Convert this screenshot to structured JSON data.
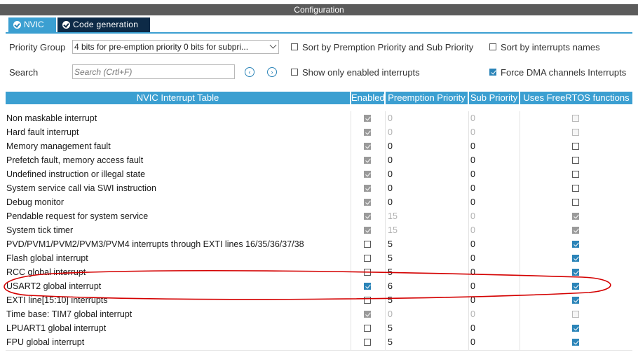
{
  "window": {
    "title": "Configuration"
  },
  "tabs": [
    {
      "label": "NVIC",
      "active": true
    },
    {
      "label": "Code generation",
      "active": false
    }
  ],
  "controls": {
    "priority_group_label": "Priority Group",
    "priority_group_value": "4 bits for pre-emption priority 0 bits for subpri...",
    "search_label": "Search",
    "search_placeholder": "Search (Crtl+F)",
    "sort_priority_label": "Sort by Premption Priority and Sub Priority",
    "sort_priority_checked": false,
    "sort_names_label": "Sort by interrupts names",
    "sort_names_checked": false,
    "show_enabled_label": "Show only enabled interrupts",
    "show_enabled_checked": false,
    "force_dma_label": "Force DMA channels Interrupts",
    "force_dma_checked": true
  },
  "table": {
    "headers": [
      "NVIC Interrupt Table",
      "Enabled",
      "Preemption Priority",
      "Sub Priority",
      "Uses FreeRTOS functions"
    ],
    "rows": [
      {
        "name": "Non maskable interrupt",
        "enabled": true,
        "enabled_locked": true,
        "preemption": "0",
        "sub": "0",
        "values_locked": true,
        "freertos": false,
        "freertos_locked": true
      },
      {
        "name": "Hard fault interrupt",
        "enabled": true,
        "enabled_locked": true,
        "preemption": "0",
        "sub": "0",
        "values_locked": true,
        "freertos": false,
        "freertos_locked": true
      },
      {
        "name": "Memory management fault",
        "enabled": true,
        "enabled_locked": true,
        "preemption": "0",
        "sub": "0",
        "values_locked": false,
        "freertos": false,
        "freertos_locked": false
      },
      {
        "name": "Prefetch fault, memory access fault",
        "enabled": true,
        "enabled_locked": true,
        "preemption": "0",
        "sub": "0",
        "values_locked": false,
        "freertos": false,
        "freertos_locked": false
      },
      {
        "name": "Undefined instruction or illegal state",
        "enabled": true,
        "enabled_locked": true,
        "preemption": "0",
        "sub": "0",
        "values_locked": false,
        "freertos": false,
        "freertos_locked": false
      },
      {
        "name": "System service call via SWI instruction",
        "enabled": true,
        "enabled_locked": true,
        "preemption": "0",
        "sub": "0",
        "values_locked": false,
        "freertos": false,
        "freertos_locked": false
      },
      {
        "name": "Debug monitor",
        "enabled": true,
        "enabled_locked": true,
        "preemption": "0",
        "sub": "0",
        "values_locked": false,
        "freertos": false,
        "freertos_locked": false
      },
      {
        "name": "Pendable request for system service",
        "enabled": true,
        "enabled_locked": true,
        "preemption": "15",
        "sub": "0",
        "values_locked": true,
        "freertos": true,
        "freertos_locked": true
      },
      {
        "name": "System tick timer",
        "enabled": true,
        "enabled_locked": true,
        "preemption": "15",
        "sub": "0",
        "values_locked": true,
        "freertos": true,
        "freertos_locked": true
      },
      {
        "name": "PVD/PVM1/PVM2/PVM3/PVM4 interrupts through EXTI lines 16/35/36/37/38",
        "enabled": false,
        "enabled_locked": false,
        "preemption": "5",
        "sub": "0",
        "values_locked": false,
        "freertos": true,
        "freertos_locked": false
      },
      {
        "name": "Flash global interrupt",
        "enabled": false,
        "enabled_locked": false,
        "preemption": "5",
        "sub": "0",
        "values_locked": false,
        "freertos": true,
        "freertos_locked": false
      },
      {
        "name": "RCC global interrupt",
        "enabled": false,
        "enabled_locked": false,
        "preemption": "5",
        "sub": "0",
        "values_locked": false,
        "freertos": true,
        "freertos_locked": false
      },
      {
        "name": "USART2 global interrupt",
        "enabled": true,
        "enabled_locked": false,
        "preemption": "6",
        "sub": "0",
        "values_locked": false,
        "freertos": true,
        "freertos_locked": false
      },
      {
        "name": "EXTI line[15:10] interrupts",
        "enabled": false,
        "enabled_locked": false,
        "preemption": "5",
        "sub": "0",
        "values_locked": false,
        "freertos": true,
        "freertos_locked": false
      },
      {
        "name": "Time base: TIM7 global interrupt",
        "enabled": true,
        "enabled_locked": true,
        "preemption": "0",
        "sub": "0",
        "values_locked": true,
        "freertos": false,
        "freertos_locked": true
      },
      {
        "name": "LPUART1 global interrupt",
        "enabled": false,
        "enabled_locked": false,
        "preemption": "5",
        "sub": "0",
        "values_locked": false,
        "freertos": true,
        "freertos_locked": false
      },
      {
        "name": "FPU global interrupt",
        "enabled": false,
        "enabled_locked": false,
        "preemption": "5",
        "sub": "0",
        "values_locked": false,
        "freertos": true,
        "freertos_locked": false
      }
    ]
  },
  "colors": {
    "accent": "#3b9fd1",
    "tab_dark": "#0d2a47",
    "annotation_red": "#d40000"
  }
}
